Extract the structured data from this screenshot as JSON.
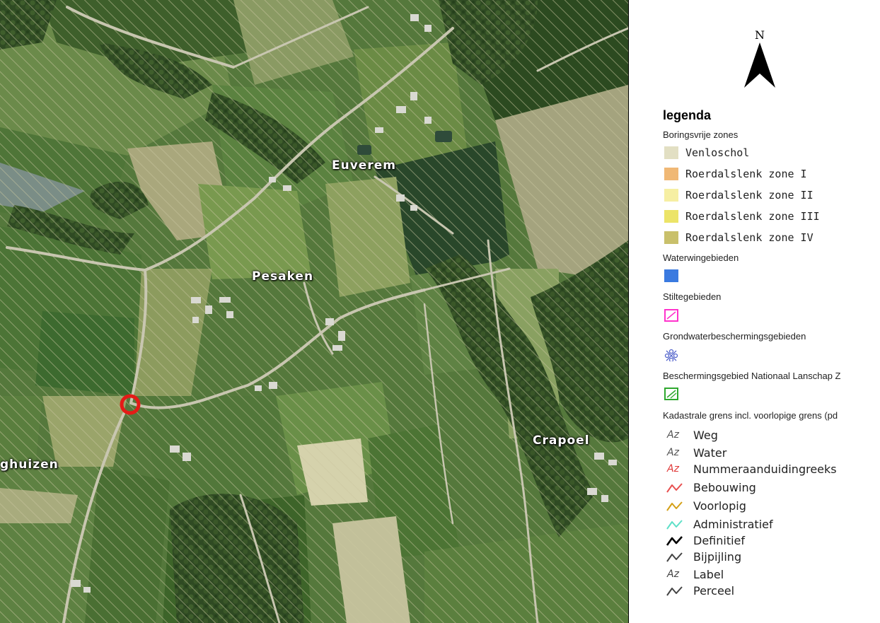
{
  "map": {
    "places": [
      "Euverem",
      "Pesaken",
      "Crapoel",
      "ghuizen"
    ],
    "marker": "location-marker"
  },
  "legend": {
    "north": "N",
    "title": "legenda",
    "sections": {
      "boringsvrij": "Boringsvrije zones",
      "waterwin": "Waterwingebieden",
      "stilte": "Stiltegebieden",
      "grondwater": "Grondwaterbeschermingsgebieden",
      "nationaal": "Beschermingsgebied Nationaal Lanschap Z",
      "kadastraal": "Kadastrale grens incl. voorlopige grens (pd"
    },
    "zones": [
      {
        "label": "Venloschol",
        "color": "#e2dfc3"
      },
      {
        "label": "Roerdalslenk zone I",
        "color": "#f0b875"
      },
      {
        "label": "Roerdalslenk zone II",
        "color": "#f6efa3"
      },
      {
        "label": "Roerdalslenk zone III",
        "color": "#ece468"
      },
      {
        "label": "Roerdalslenk zone IV",
        "color": "#c9c06b"
      }
    ],
    "waterwin_color": "#3a7ae0",
    "stilte_color": "#ff33cc",
    "grondwater_color": "#5566cc",
    "nationaal_color": "#2ea82e",
    "kadastraal_items": [
      {
        "label": "Weg",
        "kind": "az",
        "color": "#555555",
        "glyph": "Az"
      },
      {
        "label": "Water",
        "kind": "az",
        "color": "#555555",
        "glyph": "Az"
      },
      {
        "label": "Nummeraanduidingreeks",
        "kind": "az",
        "color": "#e03a3a",
        "glyph": "Az"
      },
      {
        "label": "Bebouwing",
        "kind": "line",
        "color": "#e85050"
      },
      {
        "label": "Voorlopig",
        "kind": "line",
        "color": "#d4a017"
      },
      {
        "label": "Administratief",
        "kind": "line",
        "color": "#5ee0c8"
      },
      {
        "label": "Definitief",
        "kind": "line",
        "color": "#000000"
      },
      {
        "label": "Bijpijling",
        "kind": "line",
        "color": "#444444"
      },
      {
        "label": "Label",
        "kind": "az",
        "color": "#444444",
        "glyph": "Az"
      },
      {
        "label": "Perceel",
        "kind": "line",
        "color": "#444444"
      }
    ]
  }
}
